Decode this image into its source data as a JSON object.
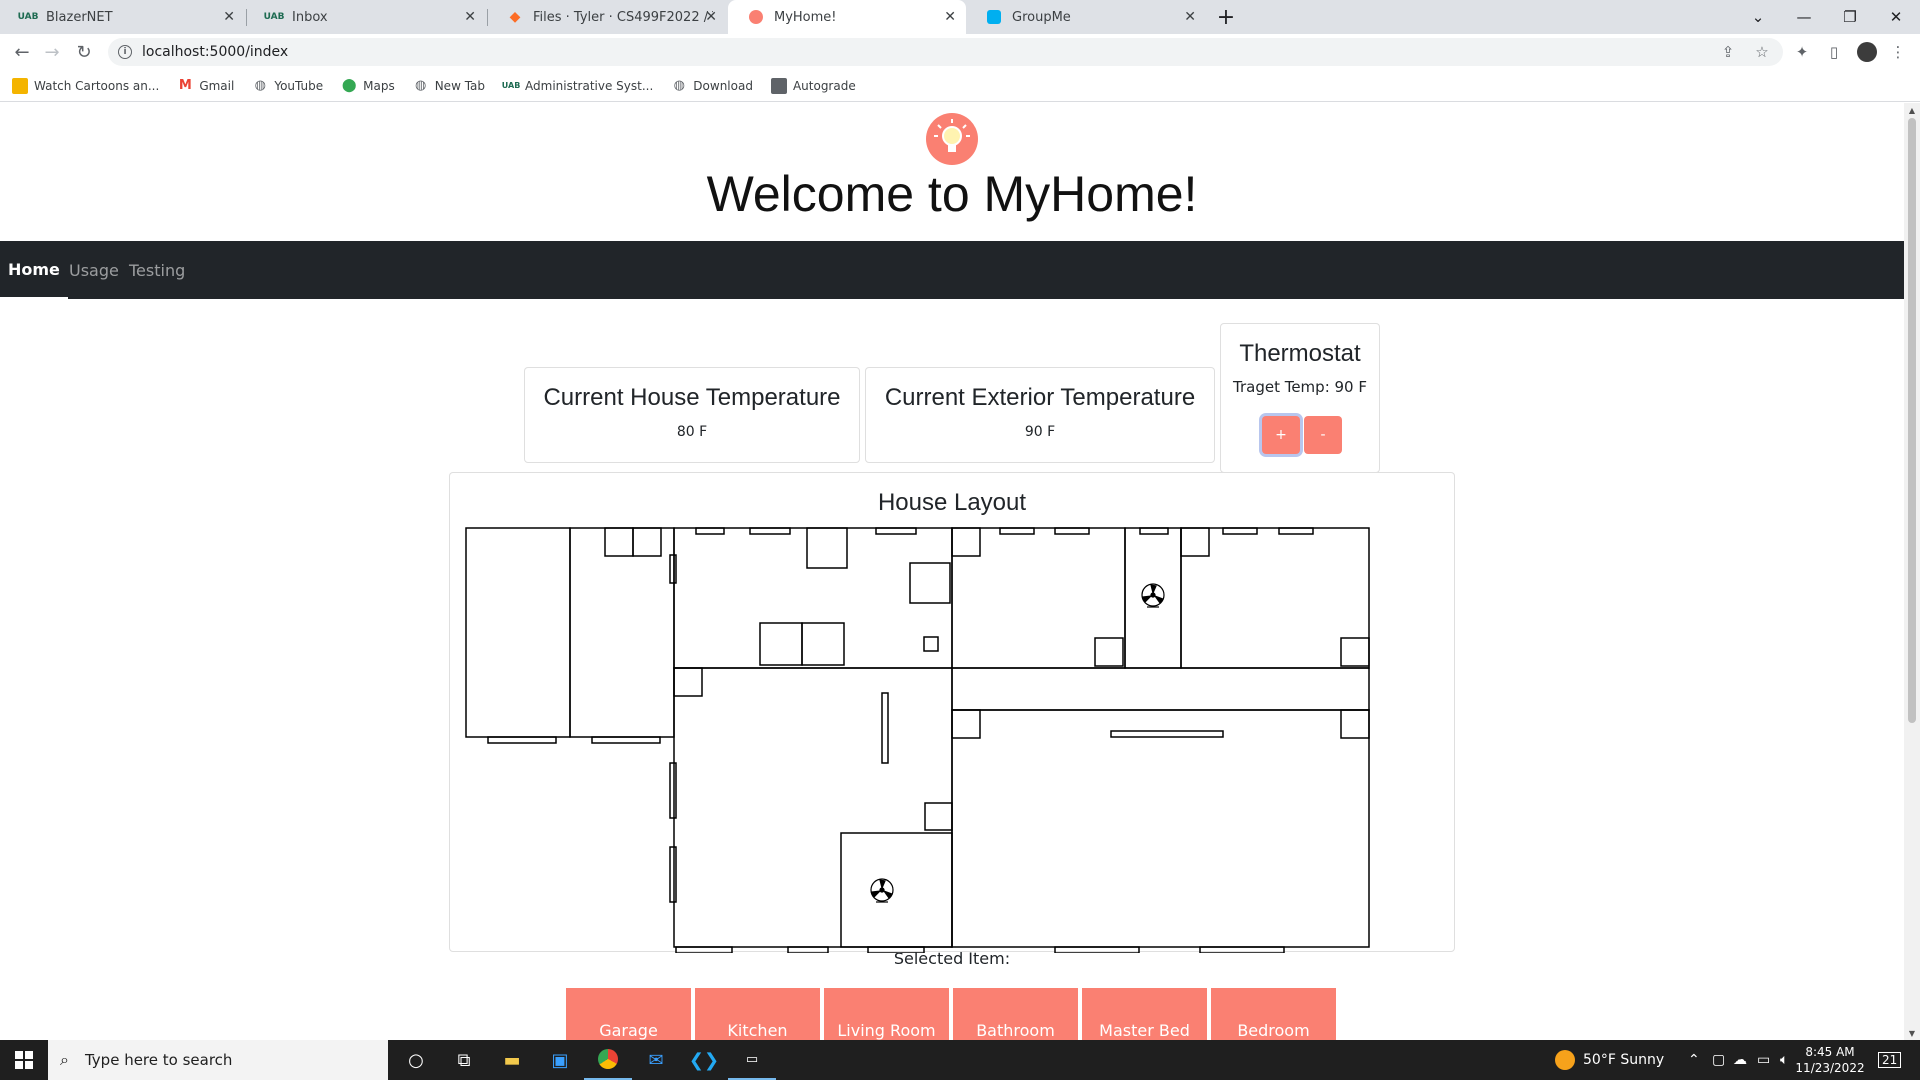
{
  "browser": {
    "tabs": [
      {
        "title": "BlazerNET",
        "icon": "uab-logo-icon"
      },
      {
        "title": "Inbox",
        "icon": "uab-logo-icon"
      },
      {
        "title": "Files · Tyler · CS499F2022 / Team",
        "icon": "gitlab-icon"
      },
      {
        "title": "MyHome!",
        "icon": "myhome-logo-icon",
        "active": true
      },
      {
        "title": "GroupMe",
        "icon": "groupme-icon"
      }
    ],
    "new_tab": "+",
    "url": "localhost:5000/index",
    "bookmarks": [
      "Watch Cartoons an...",
      "Gmail",
      "YouTube",
      "Maps",
      "New Tab",
      "Administrative Syst...",
      "Download",
      "Autograde"
    ]
  },
  "page": {
    "title": "Welcome to MyHome!",
    "nav": [
      "Home",
      "Usage",
      "Testing"
    ],
    "house_temp": {
      "label": "Current House Temperature",
      "value": "80 F"
    },
    "exterior_temp": {
      "label": "Current Exterior Temperature",
      "value": "90 F"
    },
    "thermostat": {
      "label": "Thermostat",
      "target": "Traget Temp: 90 F",
      "plus": "+",
      "minus": "-"
    },
    "layout_title": "House Layout",
    "selected_label": "Selected Item:",
    "rooms": [
      "Garage",
      "Kitchen",
      "Living Room",
      "Bathroom",
      "Master Bed",
      "Bedroom"
    ]
  },
  "taskbar": {
    "search_placeholder": "Type here to search",
    "weather": "50°F  Sunny",
    "time": "8:45 AM",
    "date": "11/23/2022",
    "notifications": "21"
  },
  "colors": {
    "accent": "#fa8072",
    "navbar": "#212529"
  }
}
